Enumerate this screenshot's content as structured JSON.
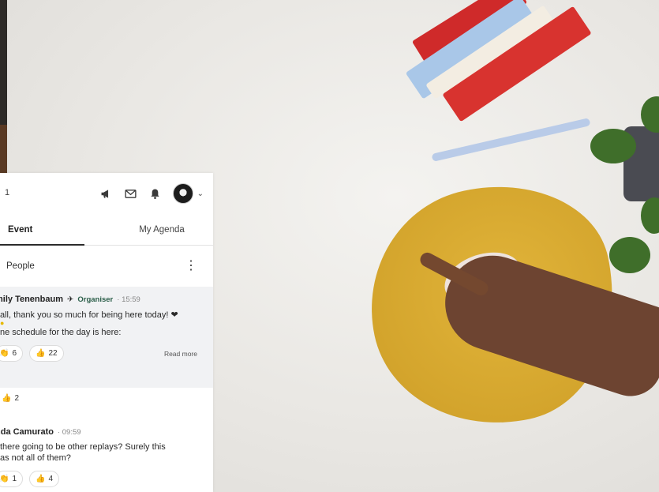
{
  "header": {
    "count": "1",
    "icons": [
      "megaphone-icon",
      "mail-icon",
      "bell-icon",
      "avatar",
      "chevron-down-icon"
    ],
    "chevron": "⌄"
  },
  "tabs": [
    {
      "label": "Event",
      "active": true
    },
    {
      "label": "My Agenda",
      "active": false
    }
  ],
  "people": {
    "label": "People",
    "menu": "⋮"
  },
  "posts": [
    {
      "author": "mily Tenenbaum",
      "pin": "📌",
      "role": "Organiser",
      "time": "· 15:59",
      "lines": [
        "all, thank you so much for being here today! ❤",
        "ne schedule for the day is here:"
      ],
      "read_more": "Read more",
      "reactions": [
        {
          "icon": "clap-icon",
          "count": "6"
        },
        {
          "icon": "thumbs-up-icon",
          "count": "22"
        }
      ]
    },
    {
      "solo_reaction": {
        "icon": "thumbs-up-icon",
        "count": "2"
      }
    },
    {
      "author": "nda Camurato",
      "time": "· 09:59",
      "lines": [
        "there going to be other replays? Surely this",
        "as not all of them?"
      ],
      "reactions": [
        {
          "icon": "clap-icon",
          "count": "1"
        },
        {
          "icon": "thumbs-up-icon",
          "count": "4"
        }
      ]
    }
  ],
  "colors": {
    "role": "#2c5f4a",
    "tab_underline": "#2c2c2c",
    "pinned_bg": "#f1f2f4"
  }
}
